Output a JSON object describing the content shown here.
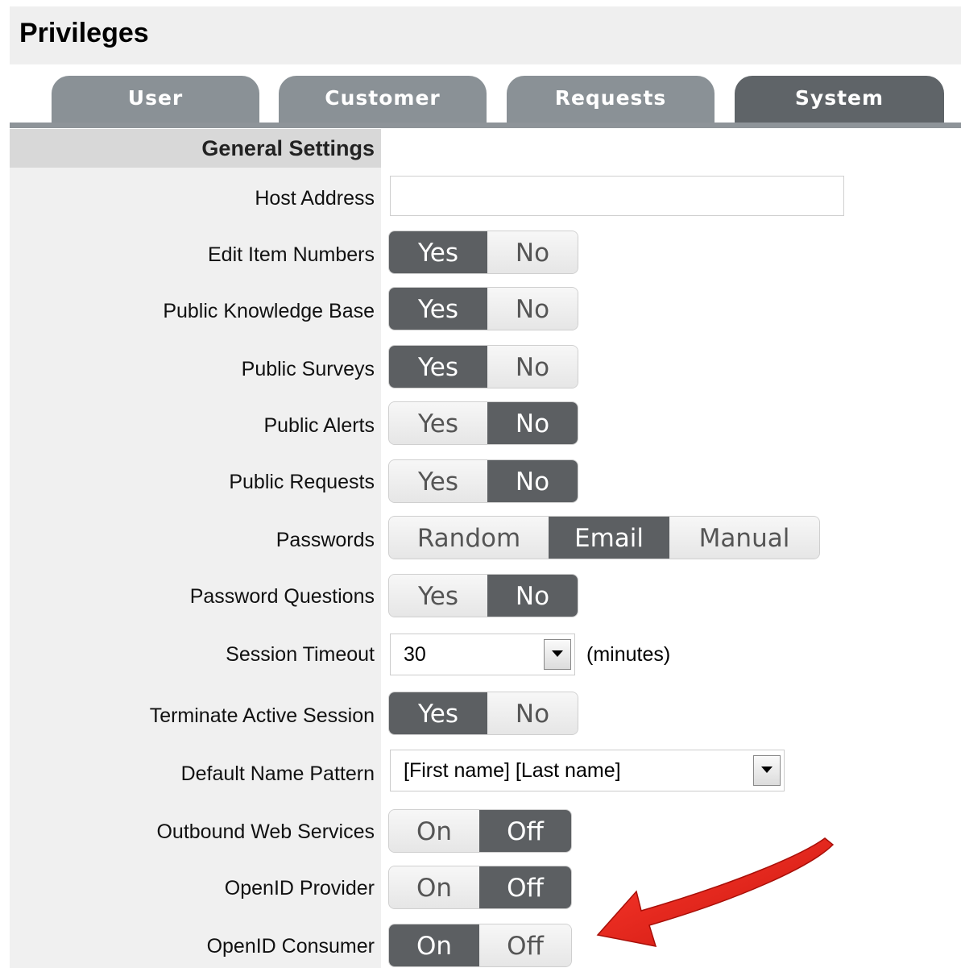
{
  "page": {
    "title": "Privileges"
  },
  "tabs": [
    {
      "label": "User",
      "active": false
    },
    {
      "label": "Customer",
      "active": false
    },
    {
      "label": "Requests",
      "active": false
    },
    {
      "label": "System",
      "active": true
    }
  ],
  "section": {
    "title": "General Settings"
  },
  "rows": {
    "host_address": {
      "label": "Host Address",
      "value": ""
    },
    "edit_item_numbers": {
      "label": "Edit Item Numbers",
      "options": [
        "Yes",
        "No"
      ],
      "selected": "Yes"
    },
    "public_knowledge_base": {
      "label": "Public Knowledge Base",
      "options": [
        "Yes",
        "No"
      ],
      "selected": "Yes"
    },
    "public_surveys": {
      "label": "Public Surveys",
      "options": [
        "Yes",
        "No"
      ],
      "selected": "Yes"
    },
    "public_alerts": {
      "label": "Public Alerts",
      "options": [
        "Yes",
        "No"
      ],
      "selected": "No"
    },
    "public_requests": {
      "label": "Public Requests",
      "options": [
        "Yes",
        "No"
      ],
      "selected": "No"
    },
    "passwords": {
      "label": "Passwords",
      "options": [
        "Random",
        "Email",
        "Manual"
      ],
      "selected": "Email"
    },
    "password_questions": {
      "label": "Password Questions",
      "options": [
        "Yes",
        "No"
      ],
      "selected": "No"
    },
    "session_timeout": {
      "label": "Session Timeout",
      "value": "30",
      "units": "(minutes)"
    },
    "terminate_active_session": {
      "label": "Terminate Active Session",
      "options": [
        "Yes",
        "No"
      ],
      "selected": "Yes"
    },
    "default_name_pattern": {
      "label": "Default Name Pattern",
      "value": "[First name] [Last name]"
    },
    "outbound_web_services": {
      "label": "Outbound Web Services",
      "options": [
        "On",
        "Off"
      ],
      "selected": "Off"
    },
    "openid_provider": {
      "label": "OpenID Provider",
      "options": [
        "On",
        "Off"
      ],
      "selected": "Off"
    },
    "openid_consumer": {
      "label": "OpenID Consumer",
      "options": [
        "On",
        "Off"
      ],
      "selected": "On"
    }
  },
  "colors": {
    "selected_segment": "#5c5f62",
    "tab_active": "#5f6468",
    "tab_inactive": "#8a9196",
    "arrow": "#e3241b"
  },
  "icons": {
    "dropdown": "chevron-down-icon",
    "annotation": "red-arrow-icon"
  }
}
